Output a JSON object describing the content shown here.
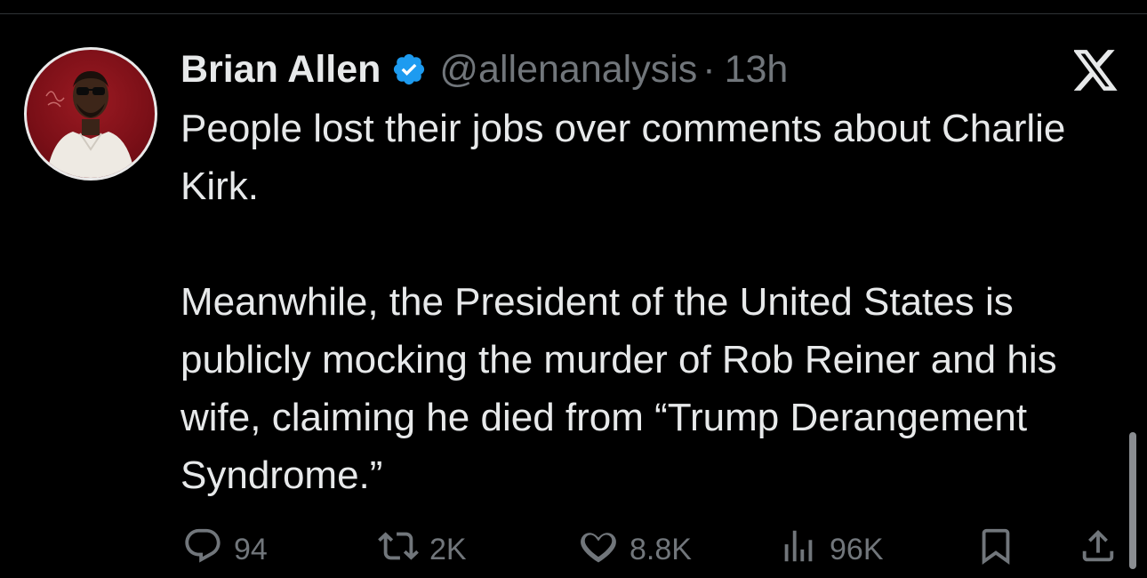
{
  "tweet": {
    "author_name": "Brian Allen",
    "handle": "@allenanalysis",
    "separator": "·",
    "time": "13h",
    "text": "People lost their jobs over comments about Charlie Kirk.\n\nMeanwhile, the President of the United States is publicly mocking the murder of Rob Reiner and his wife, claiming he died from “Trump Derangement Syndrome.”"
  },
  "actions": {
    "replies": "94",
    "reposts": "2K",
    "likes": "8.8K",
    "views": "96K"
  },
  "icons": {
    "verified": "verified-badge-icon",
    "brand": "x-logo-icon",
    "reply": "reply-icon",
    "repost": "repost-icon",
    "like": "like-icon",
    "views": "views-icon",
    "bookmark": "bookmark-icon",
    "share": "share-icon"
  },
  "colors": {
    "background": "#000000",
    "text": "#e7e9ea",
    "secondary": "#71767b",
    "verified": "#1d9bf0",
    "avatar_bg": "#8e151d"
  }
}
